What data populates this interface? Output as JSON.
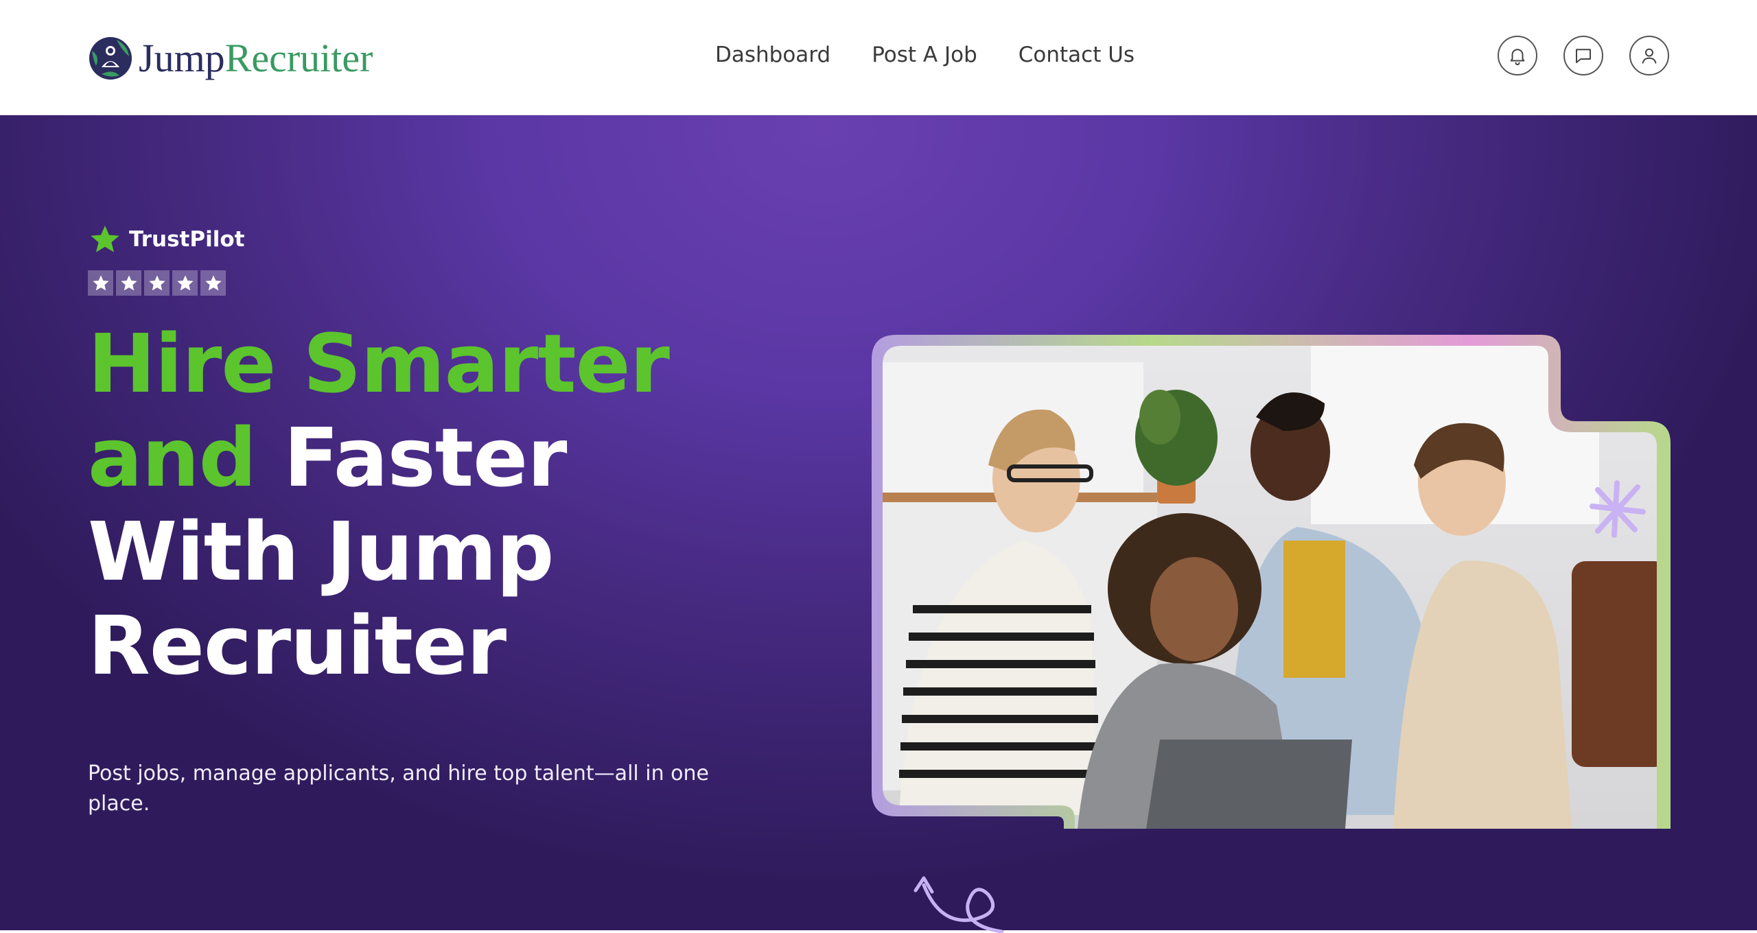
{
  "header": {
    "logo": {
      "word1": "Jump",
      "word2": "Recruiter"
    },
    "nav": [
      {
        "label": "Dashboard"
      },
      {
        "label": "Post A Job"
      },
      {
        "label": "Contact Us"
      }
    ],
    "icons": [
      "bell-icon",
      "message-icon",
      "user-icon"
    ]
  },
  "hero": {
    "trust_label": "TrustPilot",
    "rating_stars": 5,
    "headline": {
      "line1": "Hire Smarter",
      "line2a": "and",
      "line2b": "Faster",
      "line3": "With Jump",
      "line4": "Recruiter"
    },
    "subtext": "Post jobs, manage applicants, and hire top talent—all in one place."
  },
  "colors": {
    "brand_green": "#5cc42d",
    "logo_navy": "#2b2d5e",
    "logo_green": "#3a9a62",
    "hero_purple": "#5a37a4",
    "frame_green": "#b6d98a",
    "frame_pink": "#e49ad8",
    "sparkle_lilac": "#c9b2f3"
  }
}
